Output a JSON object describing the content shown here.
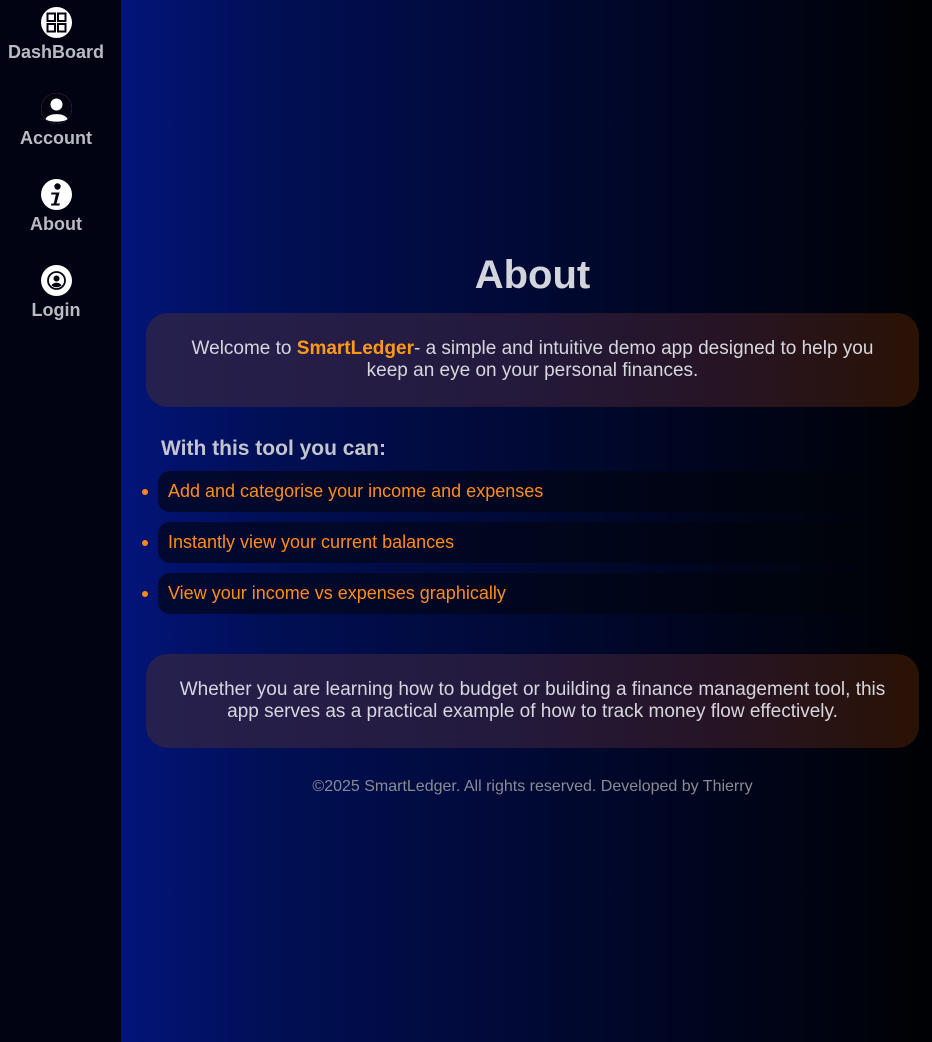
{
  "sidebar": {
    "items": [
      {
        "label": "DashBoard",
        "icon": "dashboard-icon"
      },
      {
        "label": "Account",
        "icon": "account-icon"
      },
      {
        "label": "About",
        "icon": "info-icon"
      },
      {
        "label": "Login",
        "icon": "login-user-icon"
      }
    ]
  },
  "main": {
    "title": "About",
    "intro": {
      "prefix": "Welcome to ",
      "brand": "SmartLedger",
      "suffix": "- a simple and intuitive demo app designed to help you keep an eye on your personal finances."
    },
    "features_title": "With this tool you can:",
    "features": [
      "Add and categorise your income and expenses",
      "Instantly view your current balances",
      "View your income vs expenses graphically"
    ],
    "outro": "Whether you are learning how to budget or building a finance management tool, this app serves as a practical example of how to track money flow effectively.",
    "footer": "©2025 SmartLedger. All rights reserved. Developed by Thierry"
  },
  "colors": {
    "accent": "#ff9a15",
    "sidebar_bg": "#020312",
    "main_gradient_start": "#02147a",
    "main_gradient_end": "#000104"
  }
}
